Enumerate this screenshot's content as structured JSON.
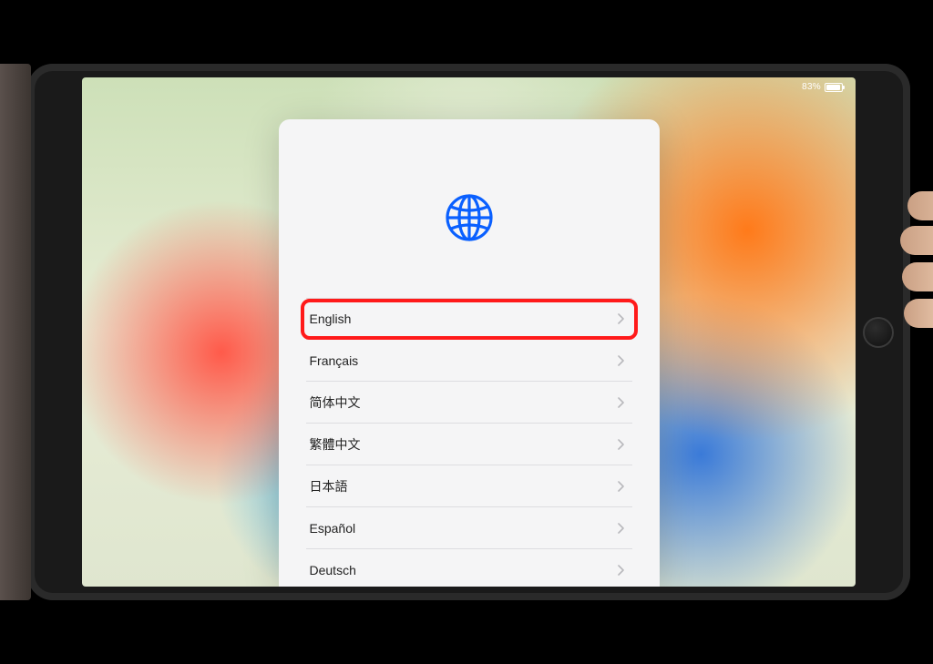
{
  "status_bar": {
    "battery_percent": "83%"
  },
  "languages": [
    {
      "label": "English"
    },
    {
      "label": "Français"
    },
    {
      "label": "简体中文"
    },
    {
      "label": "繁體中文"
    },
    {
      "label": "日本語"
    },
    {
      "label": "Español"
    },
    {
      "label": "Deutsch"
    }
  ],
  "highlight_index": 0,
  "accent_color": "#0a60ff",
  "highlight_color": "#ff1a1a"
}
